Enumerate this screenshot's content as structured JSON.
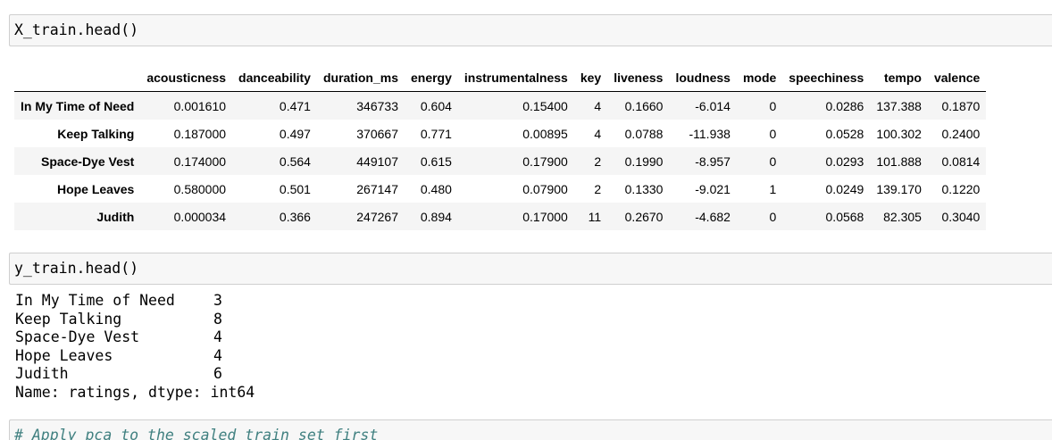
{
  "cells": {
    "cell1_code": "X_train.head()",
    "cell2_code": "y_train.head()",
    "cell3_comment": "# Apply pca to the scaled train set first"
  },
  "dataframe": {
    "columns": [
      "acousticness",
      "danceability",
      "duration_ms",
      "energy",
      "instrumentalness",
      "key",
      "liveness",
      "loudness",
      "mode",
      "speechiness",
      "tempo",
      "valence"
    ],
    "rows": [
      {
        "index": "In My Time of Need",
        "values": [
          "0.001610",
          "0.471",
          "346733",
          "0.604",
          "0.15400",
          "4",
          "0.1660",
          "-6.014",
          "0",
          "0.0286",
          "137.388",
          "0.1870"
        ]
      },
      {
        "index": "Keep Talking",
        "values": [
          "0.187000",
          "0.497",
          "370667",
          "0.771",
          "0.00895",
          "4",
          "0.0788",
          "-11.938",
          "0",
          "0.0528",
          "100.302",
          "0.2400"
        ]
      },
      {
        "index": "Space-Dye Vest",
        "values": [
          "0.174000",
          "0.564",
          "449107",
          "0.615",
          "0.17900",
          "2",
          "0.1990",
          "-8.957",
          "0",
          "0.0293",
          "101.888",
          "0.0814"
        ]
      },
      {
        "index": "Hope Leaves",
        "values": [
          "0.580000",
          "0.501",
          "267147",
          "0.480",
          "0.07900",
          "2",
          "0.1330",
          "-9.021",
          "1",
          "0.0249",
          "139.170",
          "0.1220"
        ]
      },
      {
        "index": "Judith",
        "values": [
          "0.000034",
          "0.366",
          "247267",
          "0.894",
          "0.17000",
          "11",
          "0.2670",
          "-4.682",
          "0",
          "0.0568",
          "82.305",
          "0.3040"
        ]
      }
    ]
  },
  "series": {
    "rows": [
      {
        "label": "In My Time of Need",
        "value": "3"
      },
      {
        "label": "Keep Talking",
        "value": "8"
      },
      {
        "label": "Space-Dye Vest",
        "value": "4"
      },
      {
        "label": "Hope Leaves",
        "value": "4"
      },
      {
        "label": "Judith",
        "value": "6"
      }
    ],
    "footer": "Name: ratings, dtype: int64"
  }
}
